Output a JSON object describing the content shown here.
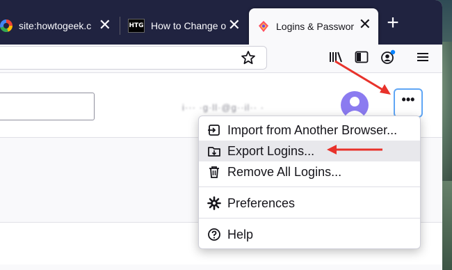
{
  "tabs": [
    {
      "title": "site:howtogeek.c",
      "icon": "google-icon",
      "active": false
    },
    {
      "title": "How to Change o",
      "icon": "htg-icon",
      "active": false
    },
    {
      "title": "Logins & Passwor",
      "icon": "lockwise-icon",
      "active": true
    }
  ],
  "htg_logo": "HTG",
  "new_tab_icon": "plus-icon",
  "page": {
    "user_text": "i··· ·g·ll·@g··il·· ·",
    "menu_button_label": "•••"
  },
  "menu": {
    "items": [
      {
        "label": "Import from Another Browser...",
        "icon": "import-icon"
      },
      {
        "label": "Export Logins...",
        "icon": "export-icon",
        "highlighted": true
      },
      {
        "label": "Remove All Logins...",
        "icon": "trash-icon"
      },
      {
        "label": "Preferences",
        "icon": "gear-icon"
      },
      {
        "label": "Help",
        "icon": "help-icon"
      }
    ]
  },
  "colors": {
    "tabstrip": "#202340",
    "annotation_arrow": "#e8322b",
    "focus_ring": "#5fa6f5",
    "avatar": "#8b7bf0"
  }
}
